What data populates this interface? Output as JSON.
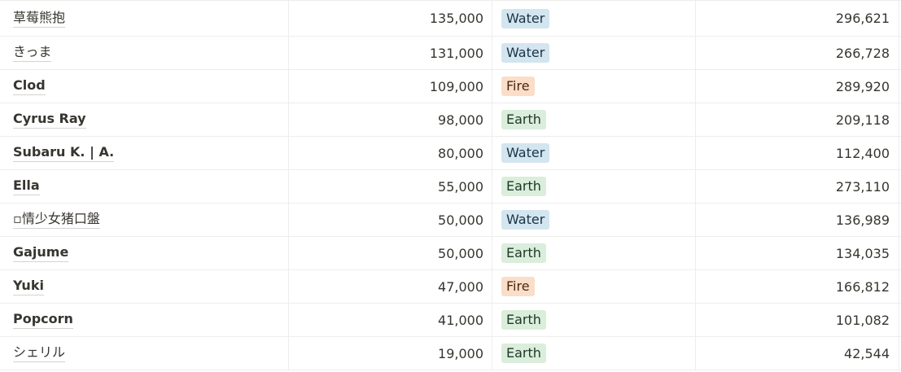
{
  "rows": [
    {
      "name": "草莓熊抱",
      "weight": "plain",
      "value1": "135,000",
      "tag": "Water",
      "tag_color": "#d3e5ef",
      "value2": "296,621"
    },
    {
      "name": "きっま",
      "weight": "plain",
      "value1": "131,000",
      "tag": "Water",
      "tag_color": "#d3e5ef",
      "value2": "266,728"
    },
    {
      "name": "Clod",
      "weight": "bold",
      "value1": "109,000",
      "tag": "Fire",
      "tag_color": "#fadec9",
      "value2": "289,920"
    },
    {
      "name": "Cyrus Ray",
      "weight": "bold",
      "value1": "98,000",
      "tag": "Earth",
      "tag_color": "#dbeddb",
      "value2": "209,118"
    },
    {
      "name": "Subaru K. | A.",
      "weight": "bold",
      "value1": "80,000",
      "tag": "Water",
      "tag_color": "#d3e5ef",
      "value2": "112,400"
    },
    {
      "name": "Ella",
      "weight": "bold",
      "value1": "55,000",
      "tag": "Earth",
      "tag_color": "#dbeddb",
      "value2": "273,110"
    },
    {
      "name": "▫情少女猪口盤",
      "weight": "plain",
      "value1": "50,000",
      "tag": "Water",
      "tag_color": "#d3e5ef",
      "value2": "136,989"
    },
    {
      "name": "Gajume",
      "weight": "bold",
      "value1": "50,000",
      "tag": "Earth",
      "tag_color": "#dbeddb",
      "value2": "134,035"
    },
    {
      "name": "Yuki",
      "weight": "bold",
      "value1": "47,000",
      "tag": "Fire",
      "tag_color": "#fadec9",
      "value2": "166,812"
    },
    {
      "name": "Popcorn",
      "weight": "bold",
      "value1": "41,000",
      "tag": "Earth",
      "tag_color": "#dbeddb",
      "value2": "101,082"
    },
    {
      "name": "シェリル",
      "weight": "plain",
      "value1": "19,000",
      "tag": "Earth",
      "tag_color": "#dbeddb",
      "value2": "42,544"
    }
  ]
}
